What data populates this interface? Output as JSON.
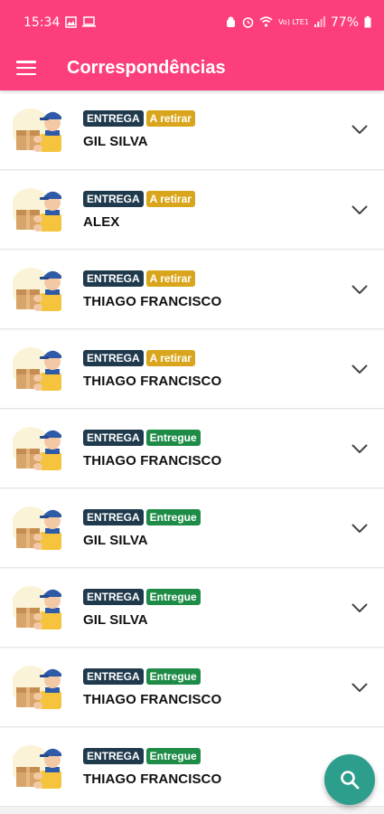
{
  "status_bar": {
    "time": "15:34",
    "left_icons": [
      "image-icon",
      "laptop-icon"
    ],
    "right_icons": [
      "android-icon",
      "alarm-icon",
      "wifi-icon",
      "lte-signal-icon"
    ],
    "network_text": "Vo) LTE1",
    "battery": "77%"
  },
  "app_bar": {
    "title": "Correspondências"
  },
  "colors": {
    "primary": "#fc3f7b",
    "badge_type": "#1f3a4d",
    "badge_pending": "#d9a51c",
    "badge_done": "#1e8c46",
    "fab": "#2e9e8c"
  },
  "items": [
    {
      "type": "ENTREGA",
      "status": "A retirar",
      "status_kind": "pending",
      "name": "GIL SILVA"
    },
    {
      "type": "ENTREGA",
      "status": "A retirar",
      "status_kind": "pending",
      "name": "ALEX"
    },
    {
      "type": "ENTREGA",
      "status": "A retirar",
      "status_kind": "pending",
      "name": "THIAGO FRANCISCO"
    },
    {
      "type": "ENTREGA",
      "status": "A retirar",
      "status_kind": "pending",
      "name": "THIAGO FRANCISCO"
    },
    {
      "type": "ENTREGA",
      "status": "Entregue",
      "status_kind": "done",
      "name": "THIAGO FRANCISCO"
    },
    {
      "type": "ENTREGA",
      "status": "Entregue",
      "status_kind": "done",
      "name": "GIL SILVA"
    },
    {
      "type": "ENTREGA",
      "status": "Entregue",
      "status_kind": "done",
      "name": "GIL SILVA"
    },
    {
      "type": "ENTREGA",
      "status": "Entregue",
      "status_kind": "done",
      "name": "THIAGO FRANCISCO"
    },
    {
      "type": "ENTREGA",
      "status": "Entregue",
      "status_kind": "done",
      "name": "THIAGO FRANCISCO"
    }
  ],
  "fab": {
    "icon": "search-icon"
  }
}
